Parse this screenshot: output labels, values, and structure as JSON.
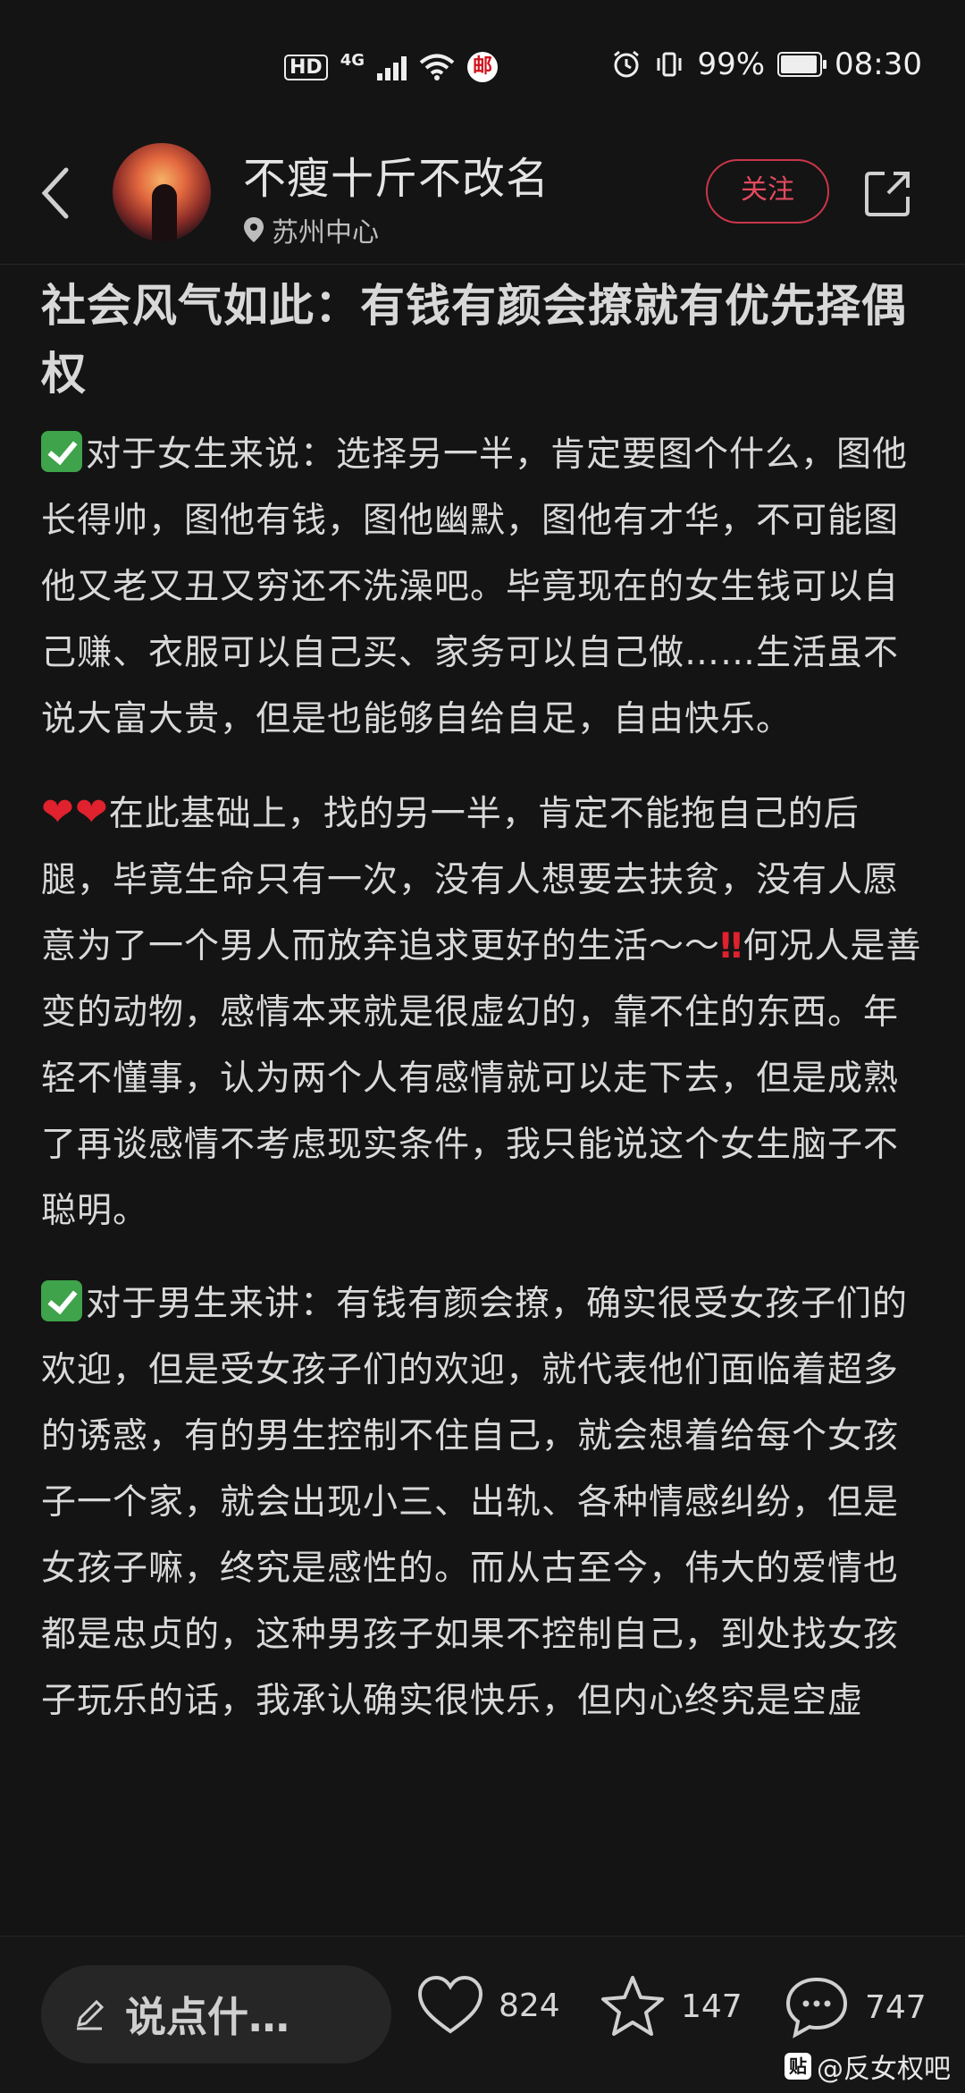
{
  "status": {
    "network_hd": "HD",
    "network_gen": "4G",
    "battery": "99%",
    "time": "08:30"
  },
  "header": {
    "username": "不瘦十斤不改名",
    "location": "苏州中心",
    "follow_label": "关注"
  },
  "post": {
    "title": "社会风气如此：有钱有颜会撩就有优先择偶权",
    "p1_text": "对于女生来说：选择另一半，肯定要图个什么，图他长得帅，图他有钱，图他幽默，图他有才华，不可能图他又老又丑又穷还不洗澡吧。毕竟现在的女生钱可以自己赚、衣服可以自己买、家务可以自己做……生活虽不说大富大贵，但是也能够自给自足，自由快乐。",
    "p2_a": "在此基础上，找的另一半，肯定不能拖自己的后腿，毕竟生命只有一次，没有人想要去扶贫，没有人愿意为了一个男人而放弃追求更好的生活～～",
    "p2_b": "何况人是善变的动物，感情本来就是很虚幻的，靠不住的东西。年轻不懂事，认为两个人有感情就可以走下去，但是成熟了再谈感情不考虑现实条件，我只能说这个女生脑子不聪明。",
    "p3_text": "对于男生来讲：有钱有颜会撩，确实很受女孩子们的欢迎，但是受女孩子们的欢迎，就代表他们面临着超多的诱惑，有的男生控制不住自己，就会想着给每个女孩子一个家，就会出现小三、出轨、各种情感纠纷，但是女孩子嘛，终究是感性的。而从古至今，伟大的爱情也都是忠贞的，这种男孩子如果不控制自己，到处找女孩子玩乐的话，我承认确实很快乐，但内心终究是空虚"
  },
  "bottom": {
    "comment_placeholder": "说点什…",
    "likes": "824",
    "favorites": "147",
    "comments": "747",
    "watermark": "@反女权吧",
    "watermark_icon": "贴"
  },
  "colors": {
    "background": "#141414",
    "accent": "#e34a5e",
    "emoji_red": "#e0212e",
    "emoji_green": "#3ea34a"
  }
}
